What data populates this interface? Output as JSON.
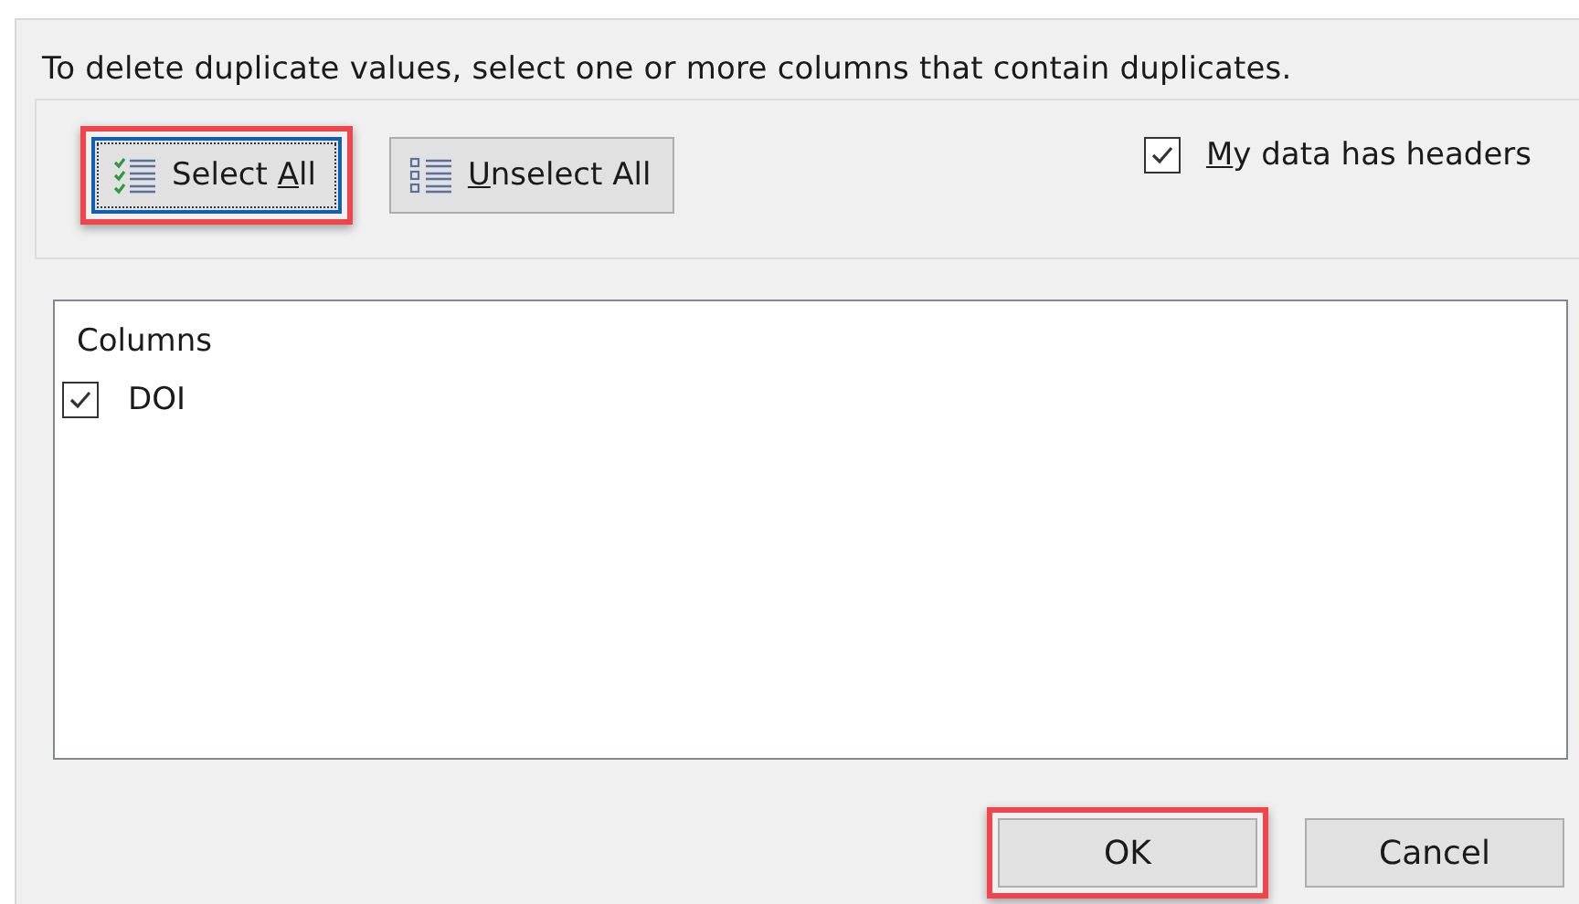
{
  "instruction": "To delete duplicate values, select one or more columns that contain duplicates.",
  "toolbar_buttons": [
    {
      "kind": "select",
      "before": "Select ",
      "mnemonic": "A",
      "after": "ll",
      "highlighted": true,
      "focused": true
    },
    {
      "kind": "unselect",
      "mnemonic": "U",
      "after": "nselect All",
      "highlighted": false,
      "focused": false
    }
  ],
  "headers_option": {
    "mnemonic": "M",
    "after": "y data has headers",
    "checked": true
  },
  "columns_list": {
    "header": "Columns",
    "items": [
      {
        "label": "DOI",
        "checked": true
      }
    ]
  },
  "buttons": [
    {
      "label": "OK",
      "highlighted": true
    },
    {
      "label": "Cancel",
      "highlighted": false
    }
  ]
}
